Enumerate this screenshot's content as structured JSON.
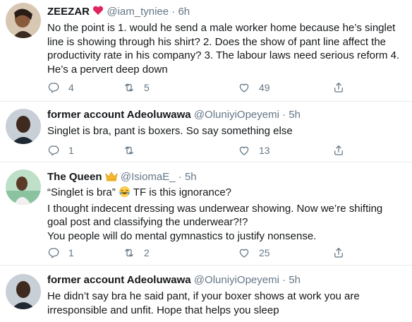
{
  "tweets": [
    {
      "name": "ZEEZAR",
      "badge": "heart",
      "handle": "@iam_tyniee",
      "sep": "·",
      "time": "6h",
      "lines": [
        "No the point is 1. would he send a male worker home because he’s singlet",
        "line is showing through his shirt? 2. Does the show of pant line affect the",
        "productivity rate in his company? 3. The labour laws need serious reform 4.",
        "He’s a pervert deep down"
      ],
      "replies": "4",
      "retweets": "5",
      "likes": "49"
    },
    {
      "name": "former account Adeoluwawa",
      "handle": "@OluniyiOpeyemi",
      "sep": "·",
      "time": "5h",
      "lines": [
        "Singlet is bra, pant is boxers. So say something else"
      ],
      "replies": "1",
      "retweets": "",
      "likes": "13"
    },
    {
      "name": "The Queen",
      "badge": "crown",
      "handle": "@IsiomaE_",
      "sep": "·",
      "time": "5h",
      "line1_pre": "“Singlet is bra”",
      "line1_post": "TF is this ignorance?",
      "lines": [
        "I thought indecent dressing was underwear showing. Now we’re shifting",
        "goal post and classifying the underwear?!?",
        "You people will do mental gymnastics to justify nonsense."
      ],
      "replies": "1",
      "retweets": "2",
      "likes": "25"
    },
    {
      "name": "former account Adeoluwawa",
      "handle": "@OluniyiOpeyemi",
      "sep": "·",
      "time": "5h",
      "lines": [
        "He didn’t say bra he said pant, if your boxer shows at work you are",
        "irresponsible and unfit. Hope that helps you sleep"
      ]
    }
  ],
  "colors": {
    "muted": "#657786",
    "text": "#14171a",
    "heart": "#e0245e",
    "divider": "#e6ecf0"
  },
  "icons": [
    "reply-icon",
    "retweet-icon",
    "like-icon",
    "share-icon",
    "heart-emoji-icon",
    "crown-emoji-icon",
    "laughing-emoji-icon"
  ]
}
